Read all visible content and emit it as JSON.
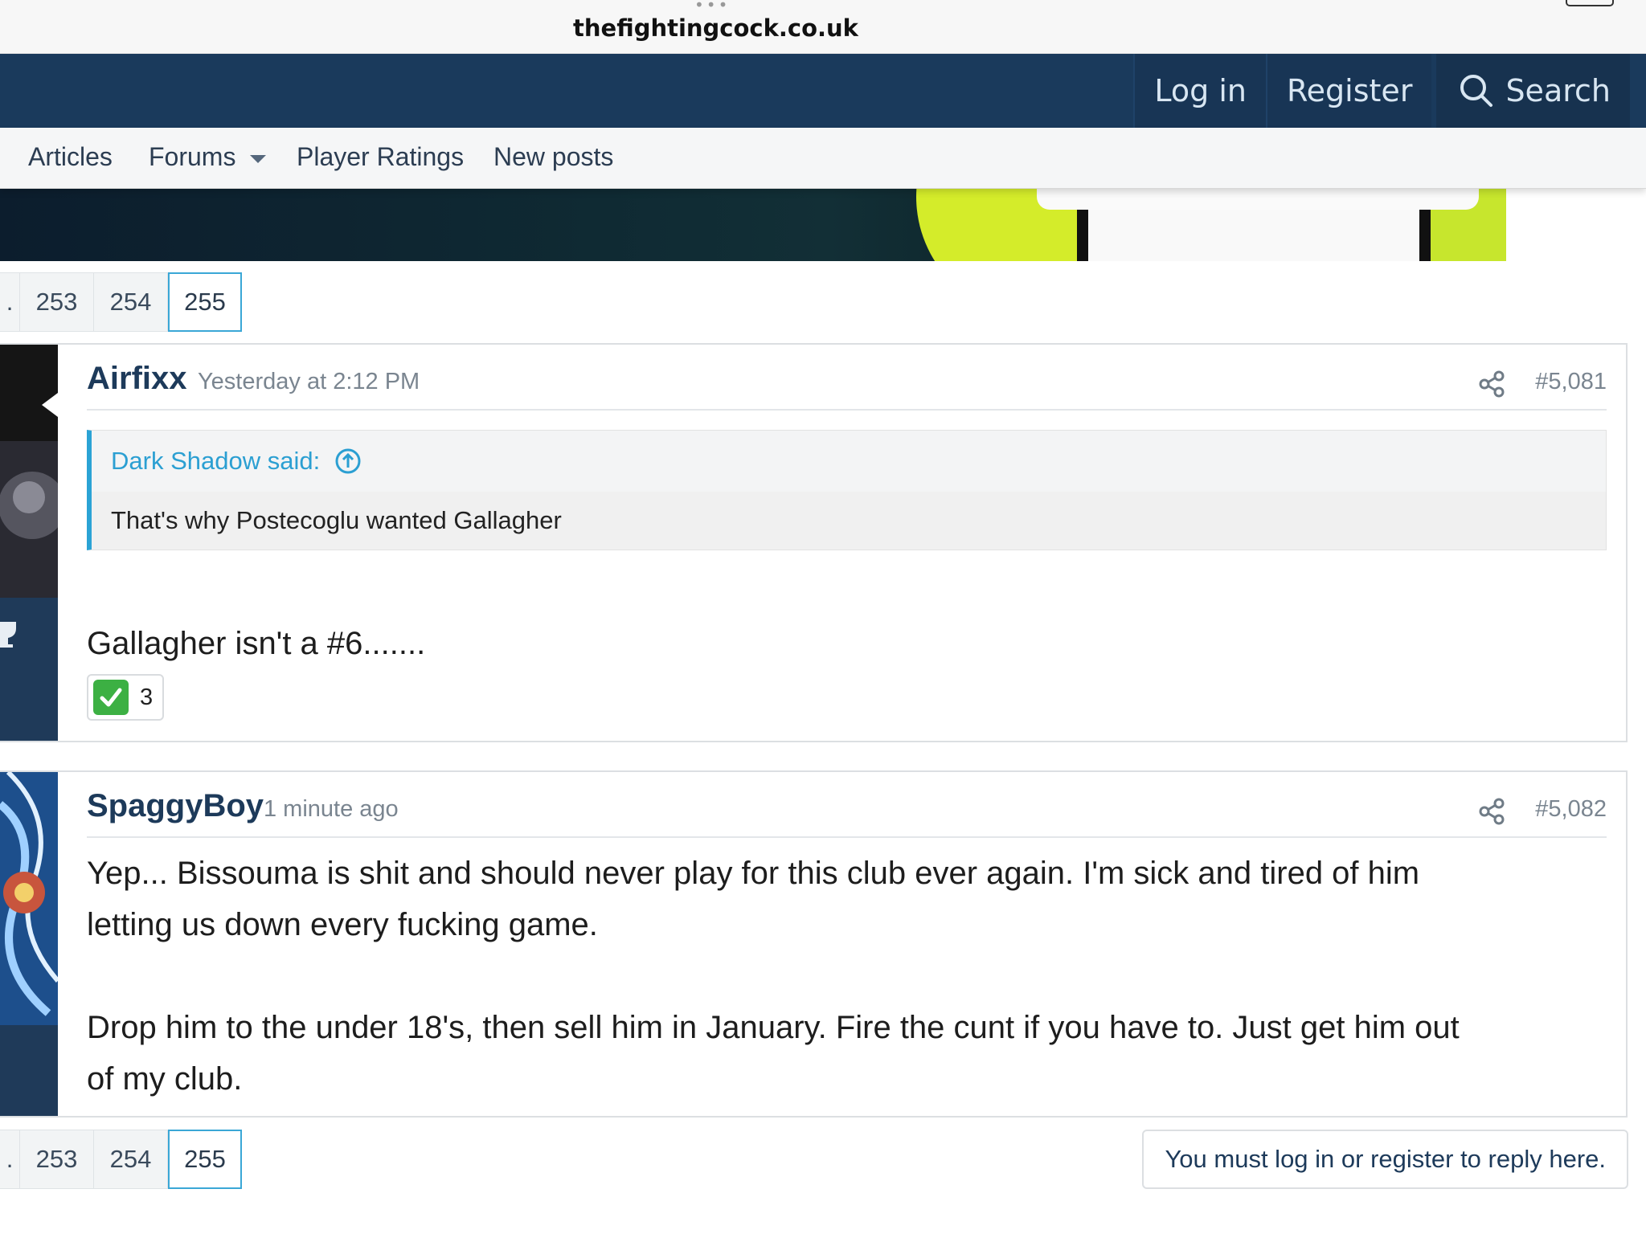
{
  "browser": {
    "url": "thefightingcock.co.uk"
  },
  "header": {
    "login_label": "Log in",
    "register_label": "Register",
    "search_label": "Search",
    "bg_color": "#1a3a5c"
  },
  "subnav": {
    "items": [
      "Articles",
      "Forums",
      "Player Ratings",
      "New posts"
    ]
  },
  "pagination": {
    "ellipsis": ".",
    "pages": [
      "253",
      "254",
      "255"
    ],
    "current": "255"
  },
  "posts": [
    {
      "username": "Airfixx",
      "time": "Yesterday at 2:12 PM",
      "number": "#5,081",
      "quote": {
        "author_label": "Dark Shadow said:",
        "text": "That's why Postecoglu wanted Gallagher"
      },
      "message": "Gallagher isn't a #6.......",
      "reaction_count": "3"
    },
    {
      "username": "SpaggyBoy",
      "time": "1 minute ago",
      "number": "#5,082",
      "message_lines": [
        "Yep... Bissouma is shit and should never play for this club ever again. I'm sick and tired of him",
        "letting us down every fucking game.",
        "",
        "Drop him to the under 18's, then sell him in January. Fire the cunt if you have to. Just get him out",
        "of my club."
      ]
    }
  ],
  "reply_note": "You must log in or register to reply here.",
  "colors": {
    "accent": "#2ba3d5",
    "username": "#1d3a5a",
    "reaction_green": "#3cb043"
  }
}
